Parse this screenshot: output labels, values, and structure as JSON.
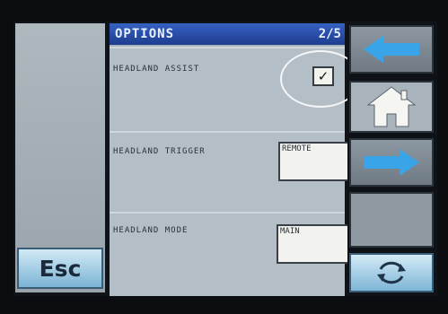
{
  "header": {
    "title": "OPTIONS",
    "page_indicator": "2/5"
  },
  "settings": [
    {
      "label": "HEADLAND ASSIST",
      "control": "checkbox",
      "checked": true,
      "mark": "✓"
    },
    {
      "label": "HEADLAND TRIGGER",
      "control": "field",
      "value": "REMOTE"
    },
    {
      "label": "HEADLAND MODE",
      "control": "field",
      "value": "MAIN"
    }
  ],
  "buttons": {
    "esc": "Esc"
  },
  "icons": {
    "back": "arrow-left-icon",
    "home": "home-icon",
    "forward": "arrow-right-icon",
    "refresh": "refresh-icon"
  },
  "colors": {
    "title_bar": "#2a50a8",
    "arrow": "#3aa4e8",
    "esc_button": "#a9d3ea"
  }
}
